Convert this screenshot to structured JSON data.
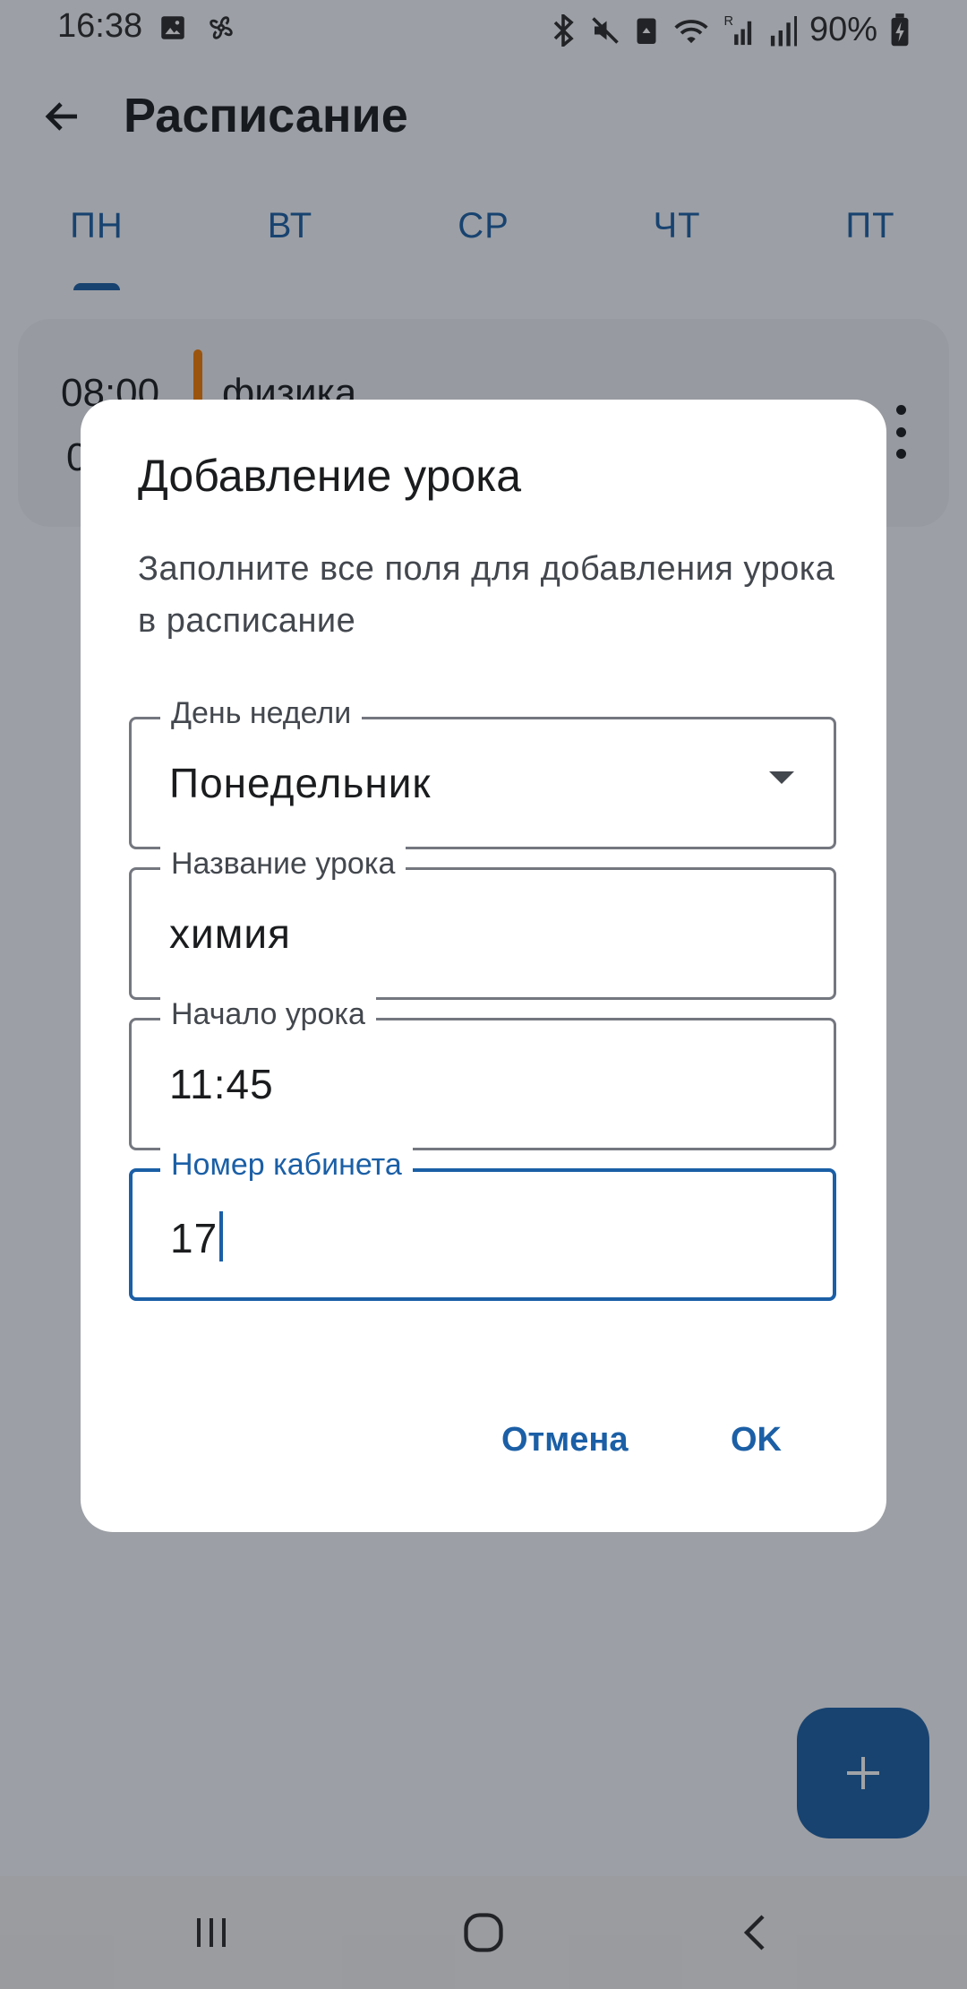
{
  "status_bar": {
    "time": "16:38",
    "battery": "90%",
    "icons": [
      "image-icon",
      "fan-icon",
      "bluetooth-icon",
      "mute-icon",
      "recycle-icon",
      "wifi-icon",
      "signal-r-icon",
      "signal-icon",
      "battery-charging-icon"
    ]
  },
  "app_bar": {
    "title": "Расписание",
    "back_icon": "arrow-left-icon"
  },
  "tabs": [
    {
      "label": "ПН",
      "selected": true
    },
    {
      "label": "ВТ",
      "selected": false
    },
    {
      "label": "СР",
      "selected": false
    },
    {
      "label": "ЧТ",
      "selected": false
    },
    {
      "label": "ПТ",
      "selected": false
    }
  ],
  "lesson_card": {
    "start_time": "08:00",
    "end_time_partial": "0",
    "subject": "физика",
    "accent_color": "#f57c00"
  },
  "dialog": {
    "title": "Добавление урока",
    "supporting_text": "Заполните все поля для добавления урока в расписание",
    "fields": {
      "day": {
        "label": "День недели",
        "value": "Понедельник"
      },
      "name": {
        "label": "Название урока",
        "value": "химия"
      },
      "start": {
        "label": "Начало урока",
        "value": "11:45"
      },
      "room": {
        "label": "Номер кабинета",
        "value": "17"
      }
    },
    "cancel_label": "Отмена",
    "ok_label": "OK"
  },
  "fab": {
    "icon": "plus-icon"
  },
  "nav_bar": {
    "icons": [
      "recents-icon",
      "home-icon",
      "back-icon"
    ]
  },
  "colors": {
    "primary": "#1b5fa6",
    "accent": "#f57c00"
  }
}
